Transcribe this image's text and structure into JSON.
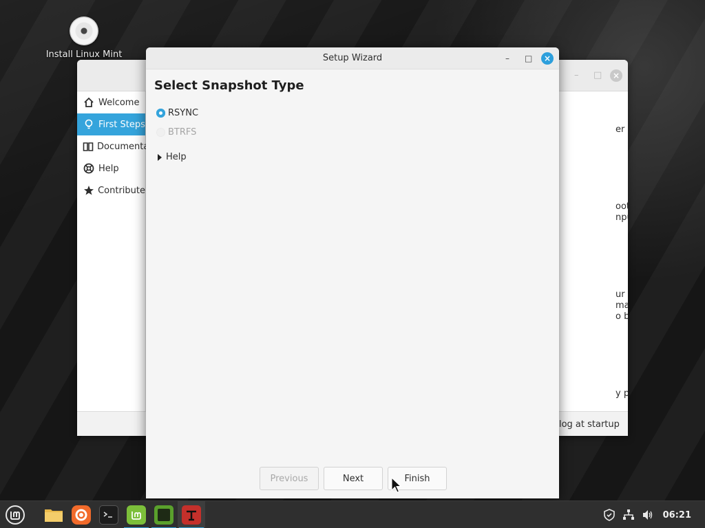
{
  "desktop": {
    "icon_label": "Install Linux Mint"
  },
  "welcome_window": {
    "sidebar": {
      "items": [
        {
          "label": "Welcome",
          "icon": "home-icon"
        },
        {
          "label": "First Steps",
          "icon": "lightbulb-icon",
          "active": true
        },
        {
          "label": "Documenta",
          "icon": "book-icon"
        },
        {
          "label": "Help",
          "icon": "lifebuoy-icon"
        },
        {
          "label": "Contribute",
          "icon": "star-icon"
        }
      ]
    },
    "content_fragments": [
      "er a light or",
      "oot",
      "nputer to its",
      "ur computer.",
      "matically",
      "o be",
      "y popular"
    ],
    "footer_text": "alog at startup"
  },
  "wizard": {
    "title": "Setup Wizard",
    "minimize_glyph": "–",
    "maximize_glyph": "□",
    "close_glyph": "×",
    "heading": "Select Snapshot Type",
    "options": [
      {
        "label": "RSYNC",
        "selected": true,
        "enabled": true
      },
      {
        "label": "BTRFS",
        "selected": false,
        "enabled": false
      }
    ],
    "help_expander": "Help",
    "buttons": {
      "previous": "Previous",
      "next": "Next",
      "finish": "Finish"
    }
  },
  "taskbar": {
    "apps": [
      "menu-icon",
      "files-icon",
      "firefox-icon",
      "terminal-icon",
      "mintinstall-icon",
      "system-monitor-icon",
      "timeshift-icon"
    ],
    "clock": "06:21",
    "accent_color": "#35a4dc"
  }
}
